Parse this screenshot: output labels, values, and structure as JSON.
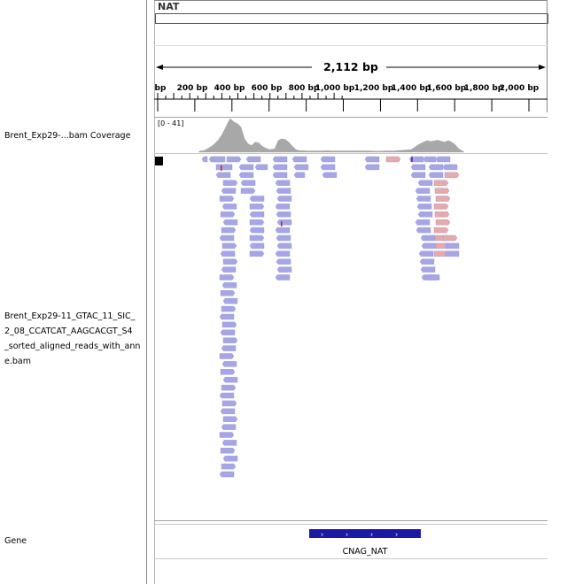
{
  "header": {
    "chromosome": "NAT",
    "span_label": "2,112 bp",
    "ruler_ticks": [
      "bp",
      "200 bp",
      "400 bp",
      "600 bp",
      "800 bp",
      "1,000 bp",
      "1,200 bp",
      "1,400 bp",
      "1,600 bp",
      "1,800 bp",
      "2,000 bp"
    ]
  },
  "tracks": {
    "coverage_name": "Brent_Exp29-...bam Coverage",
    "coverage_range": "[0 - 41]",
    "alignment_name_lines": [
      "Brent_Exp29-11_GTAC_11_SIC_",
      "2_08_CCATCAT_AAGCACGT_S4",
      "_sorted_aligned_reads_with_ann",
      "e.bam"
    ],
    "gene_name": "Gene",
    "gene_feature": "CNAG_NAT"
  },
  "colors": {
    "read_forward": "#a6a6e6",
    "read_reverse": "#e6aaaa",
    "coverage": "#a8a8a8",
    "gene": "#1a1aa6"
  }
}
